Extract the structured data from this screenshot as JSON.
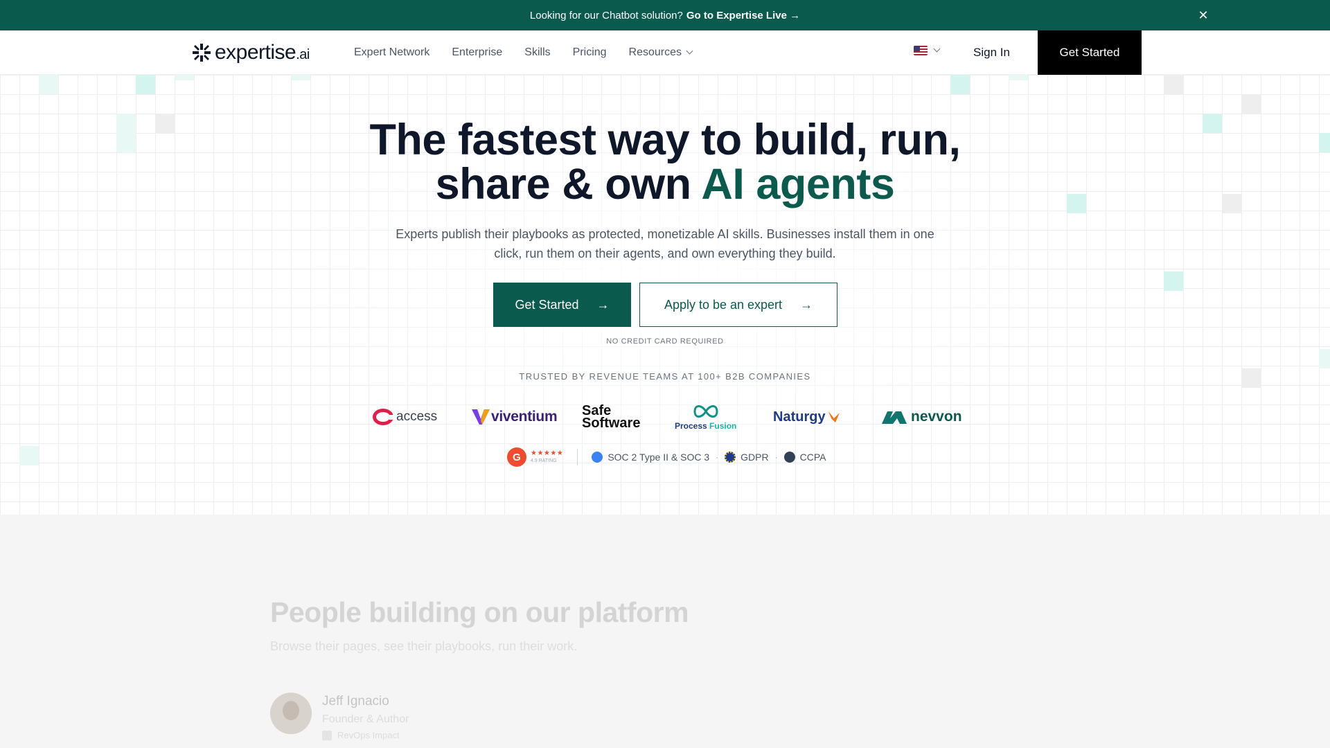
{
  "banner": {
    "text": "Looking for our Chatbot solution?",
    "cta": "Go to Expertise Live →",
    "close_icon": "close-icon"
  },
  "nav": {
    "logo": {
      "name": "expertise",
      "tld": ".ai"
    },
    "links": [
      {
        "label": "Expert Network"
      },
      {
        "label": "Enterprise"
      },
      {
        "label": "Skills"
      },
      {
        "label": "Pricing"
      },
      {
        "label": "Resources",
        "icon": "chevron-down-icon"
      }
    ],
    "locale_icon": "us-flag-icon",
    "sign_in": "Sign In",
    "cta": "Get Started"
  },
  "hero": {
    "headline_line1": "The fastest way to build, run,",
    "headline_line2": "share & own",
    "headline_accent": "AI agents",
    "subhead": "Experts publish their playbooks as protected, monetizable AI skills. Businesses install them in one click, run them on their agents, and own everything they build.",
    "primary_button": "Get Started",
    "secondary_button": "Apply to be an expert",
    "button_arrow": "→",
    "no_credit_card": "NO CREDIT CARD REQUIRED",
    "trusted": "TRUSTED BY REVENUE TEAMS AT 100+ B2B COMPANIES",
    "logos": {
      "access": "access",
      "viventium": "viventium",
      "safe_line1": "Safe",
      "safe_line2": "Software",
      "process": "Process",
      "process_fusion": "Fusion",
      "naturgy": "Naturgy",
      "nevvon": "nevvon"
    },
    "badges": {
      "g2_letter": "G",
      "g2_stars": "★★★★★",
      "g2_rating": "4.9 RATING",
      "soc": "SOC 2 Type II & SOC 3",
      "gdpr": "GDPR",
      "ccpa": "CCPA",
      "separator": "·"
    },
    "accent_color": "#0b5a4e"
  },
  "section2": {
    "title": "People building on our platform",
    "subtitle": "Browse their pages, see their playbooks, run their work.",
    "person": {
      "name": "Jeff Ignacio",
      "role": "Founder & Author",
      "tag": "RevOps Impact"
    }
  }
}
